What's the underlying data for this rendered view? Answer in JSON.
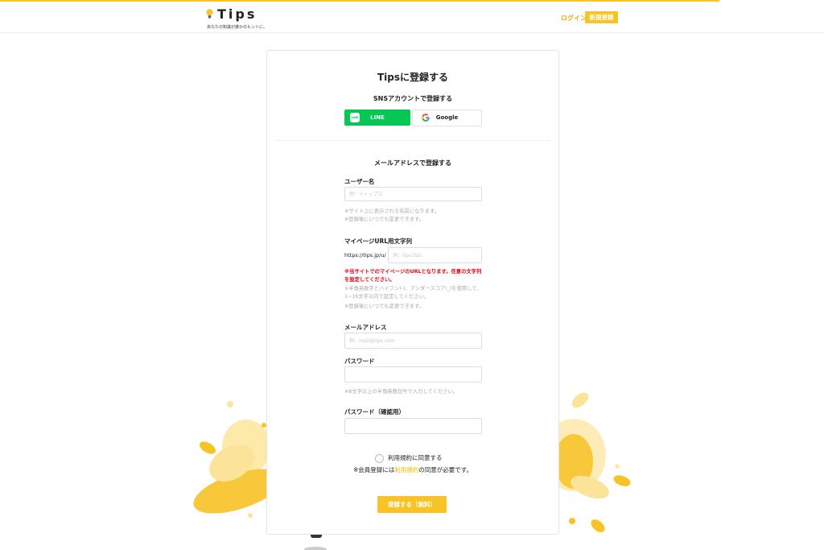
{
  "header": {
    "logo_text": "Tips",
    "tagline": "あなたの知識が誰かのヒントに。",
    "login_label": "ログイン",
    "signup_label": "新規登録"
  },
  "page": {
    "title": "Tipsに登録する"
  },
  "sns": {
    "heading": "SNSアカウントで登録する",
    "line_label": "LINE",
    "line_icon_text": "LINE",
    "google_label": "Google"
  },
  "email_section": {
    "heading": "メールアドレスで登録する"
  },
  "fields": {
    "username": {
      "label": "ユーザー名",
      "placeholder": "例：ティップス",
      "value": "",
      "help1": "※サイト上に表示される名前になります。",
      "help2": "※登録後にいつでも変更できます。"
    },
    "mypage_url": {
      "label": "マイページURL用文字列",
      "prefix": "https://tips.jp/u/",
      "placeholder": "例：tips-tips",
      "value": "",
      "warning": "※当サイトでのマイページのURLとなります。任意の文字列を設定してください。",
      "help1": "※半角英数字とハイフン(-)、アンダースコア(_)を使用して、1~16文字以内で設定してください。",
      "help2": "※登録後にいつでも変更できます。"
    },
    "email": {
      "label": "メールアドレス",
      "placeholder": "例：mail@tips.com",
      "value": ""
    },
    "password": {
      "label": "パスワード",
      "placeholder": "",
      "value": "",
      "help": "※8文字以上の半角英数記号で入力してください。"
    },
    "password_confirm": {
      "label": "パスワード（確認用）",
      "placeholder": "",
      "value": ""
    }
  },
  "agreement": {
    "label": "利用規約に同意する",
    "note_before": "※会員登録には",
    "note_link": "利用規約",
    "note_after": "の同意が必要です。",
    "checked": false
  },
  "submit": {
    "label": "登録する（無料）"
  },
  "colors": {
    "accent": "#f7c325",
    "line_green": "#06c755",
    "warning_red": "#e60012"
  },
  "icons": {
    "logo": "lightbulb-icon",
    "line": "line-logo-icon",
    "google": "google-logo-icon"
  }
}
